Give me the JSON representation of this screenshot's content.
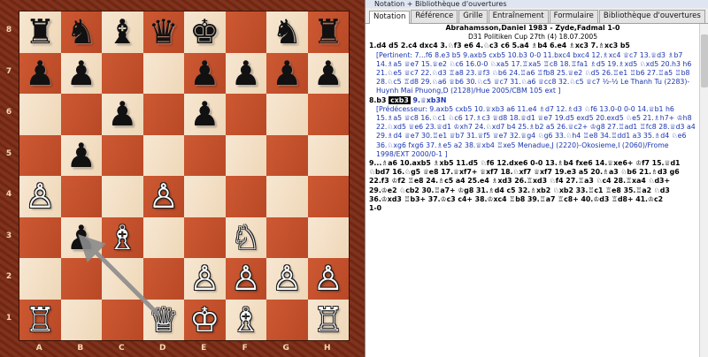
{
  "window": {
    "title": "Notation + Bibliothèque d'ouvertures"
  },
  "tabs": [
    "Notation",
    "Référence",
    "Grille",
    "Entraînement",
    "Formulaire",
    "Bibliothèque d'ouvertures"
  ],
  "board": {
    "files": [
      "A",
      "B",
      "C",
      "D",
      "E",
      "F",
      "G",
      "H"
    ],
    "ranks": [
      "8",
      "7",
      "6",
      "5",
      "4",
      "3",
      "2",
      "1"
    ],
    "pieces": {
      "a8": "♜",
      "b8": "♞",
      "c8": "♝",
      "d8": "♛",
      "e8": "♚",
      "g8": "♞",
      "h8": "♜",
      "a7": "♟",
      "b7": "♟",
      "e7": "♟",
      "f7": "♟",
      "g7": "♟",
      "h7": "♟",
      "c6": "♟",
      "e6": "♟",
      "b5": "♟",
      "a4": "♙",
      "d4": "♙",
      "b3": "♟",
      "c3": "♗",
      "f3": "♘",
      "e2": "♙",
      "f2": "♙",
      "g2": "♙",
      "h2": "♙",
      "a1": "♖",
      "d1": "♕",
      "e1": "♔",
      "f1": "♗",
      "h1": "♖"
    },
    "arrow": {
      "from": "d1",
      "to": "b3",
      "color": "#8c8c8c"
    }
  },
  "game": {
    "players": "Abrahamsson,Daniel 1983 - Zyde,Fadmal  1-0",
    "event": "D31 Politiken Cup 27th (4) 18.07.2005",
    "line1": "1.d4  d5  2.c4  dxc4  3.♘f3  e6  4.♘c3  c6  5.a4  ♗b4  6.e4  ♗xc3  7.♗xc3  b5",
    "pertinent": "[Pertinent: 7...f6  8.e3  b5  9.axb5  cxb5  10.b3  0-0  11.bxc4  bxc4  12.♗xc4  ♕c7  13.♕d3  ♗b7  14.♗a5  ♕e7  15.♕e2  ♘c6  16.0-0  ♘xa5  17.♖xa5  ♖c8  18.♖fa1  ♗d5  19.♗xd5  ♘xd5  20.h3  h6  21.♘e5  ♕c7  22.♘d3  ♖a8  23.♕f3  ♘b6  24.♖a6  ♖fb8  25.♕e2  ♘d5  26.♖e1  ♖b6  27.♖a5  ♖b8  28.♘c5  ♖d8  29.♘a6  ♕b6  30.♘c5  ♕c7  31.♘a6  ♕cc8  32.♘c5  ♕c7 ½-½ Le Thanh Tu (2283)-Huynh Mai Phuong,D (2128)/Hue  2005/CBM 105 ext ]",
    "current_pre": "8.b3",
    "current_move": "cxb3",
    "current_post": "9.♕xb3N",
    "predecessor": "[Prédécesseur:  9.axb5  cxb5  10.♕xb3  a6  11.e4  ♗d7  12.♗d3  ♘f6  13.0-0  0-0  14.♕b1  h6  15.♗a5  ♕c8  16.♘c1  ♘c6  17.♗c3  ♕d8  18.♕d1  ♕e7  19.d5  exd5  20.exd5  ♘e5  21.♗h7+  ♔h8  22.♘xd5  ♕e6  23.♕d1  ♔xh7  24.♘xd7  b4  25.♗b2  a5  26.♕c2+  ♔g8  27.♖ad1  ♖fc8  28.♕d3  a4  29.♗d4  ♕e7  30.♖e1  ♕b7  31.♕f5  ♕e7  32.♕g4  ♘g6  33.♘h4  ♖e8  34.♖dd1  a3  35.♗d4  ♘e6  36.♘xg6  fxg6  37.♗e5  a2  38.♕xb4  ♖xe5 Menadue,J (2220)-Okosieme,I (2060)/Frome 1998/EXT 2000/0-1 ]",
    "line3": "9...♗a6  10.axb5  ♗xb5  11.d5  ♘f6  12.dxe6  0-0  13.♗b4  fxe6  14.♕xe6+  ♔f7  15.♕d1  ♘bd7  16.♘g5  ♕e8  17.♕xf7+  ♕xf7  18.♘xf7  ♕xf7  19.e3  a5  20.♗a3  ♘b6  21.♗d3  g6  22.f3  ♔f2  ♖e8  24.♗c5  a4  25.e4  ♗xd3  26.♖xd3  ♘f4  27.♖a3  ♘c4  28.♖xa4  ♘d3+  29.♔e2  ♘cb2  30.♖a7+  ♔g8  31.♗d4  c5  32.♗xb2  ♘xb2  33.♖c1  ♖e8  35.♖a2  ♘d3  36.♔xd3  ♖b3+  37.♔c3  c4+  38.♔xc4  ♖b8  39.♖a7  ♖c8+  40.♔d3  ♖d8+  41.♔c2",
    "result": "1-0"
  },
  "colors": {
    "light_square": "#f4dfc3",
    "dark_square": "#c4502b",
    "frame": "#7a2a14",
    "annotation_blue": "#1a35b0"
  }
}
